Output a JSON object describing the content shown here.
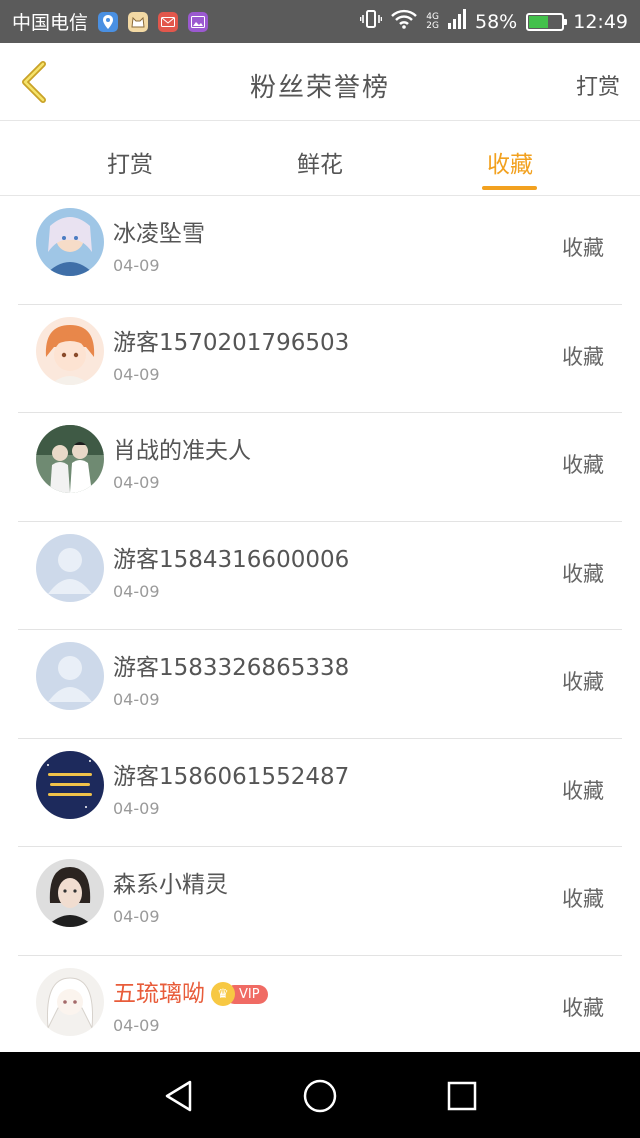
{
  "status_bar": {
    "carrier": "中国电信",
    "network_top": "4G",
    "network_bottom": "2G",
    "battery": "58%",
    "battery_level": 0.58,
    "time": "12:49",
    "app_icons": [
      "location-app-icon",
      "cat-app-icon",
      "mail-app-icon",
      "gallery-app-icon"
    ]
  },
  "header": {
    "title": "粉丝荣誉榜",
    "action": "打赏"
  },
  "tabs": [
    {
      "label": "打赏",
      "active": false
    },
    {
      "label": "鲜花",
      "active": false
    },
    {
      "label": "收藏",
      "active": true
    }
  ],
  "colors": {
    "accent": "#f2a11f",
    "vip_name": "#e85c3a",
    "status_bar": "#5b5b5b"
  },
  "list": [
    {
      "name": "冰凌坠雪",
      "date": "04-09",
      "action": "收藏",
      "avatar": "anime-avatar"
    },
    {
      "name": "游客1570201796503",
      "date": "04-09",
      "action": "收藏",
      "avatar": "anime-girl-avatar"
    },
    {
      "name": "肖战的准夫人",
      "date": "04-09",
      "action": "收藏",
      "avatar": "photo-avatar"
    },
    {
      "name": "游客1584316600006",
      "date": "04-09",
      "action": "收藏",
      "avatar": "default-avatar"
    },
    {
      "name": "游客1583326865338",
      "date": "04-09",
      "action": "收藏",
      "avatar": "default-avatar"
    },
    {
      "name": "游客1586061552487",
      "date": "04-09",
      "action": "收藏",
      "avatar": "text-avatar"
    },
    {
      "name": "森系小精灵",
      "date": "04-09",
      "action": "收藏",
      "avatar": "photo-avatar"
    },
    {
      "name": "五琉璃呦",
      "date": "04-09",
      "action": "收藏",
      "avatar": "anime-avatar",
      "vip": "VIP"
    }
  ]
}
